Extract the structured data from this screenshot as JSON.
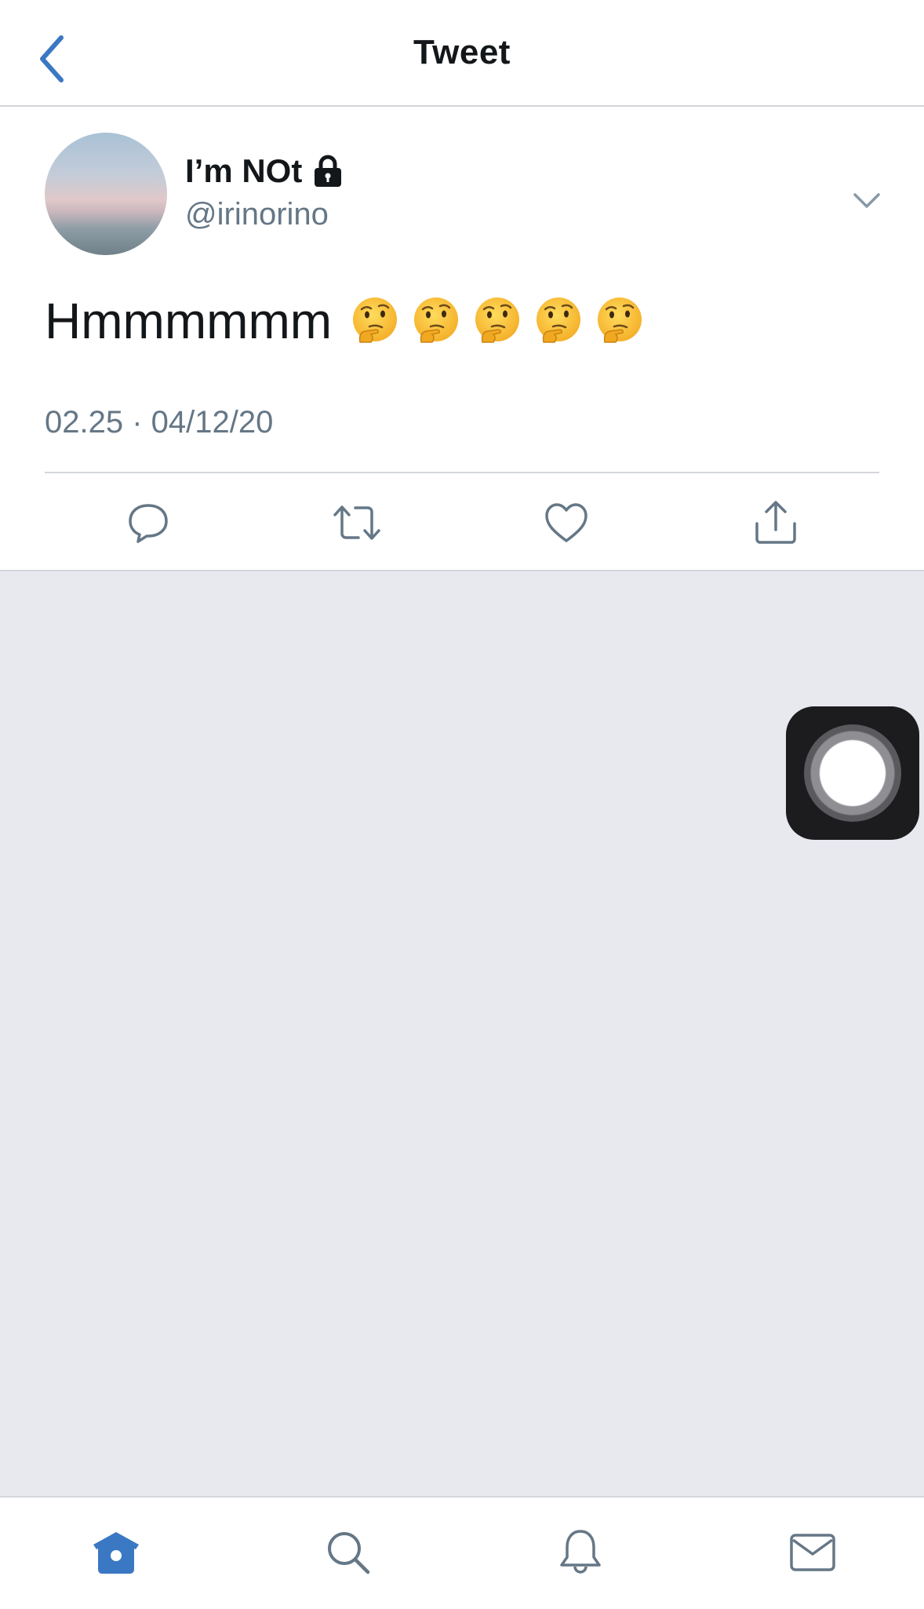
{
  "header": {
    "title": "Tweet"
  },
  "tweet": {
    "display_name": "I’m NOt",
    "handle": "@irinorino",
    "text": "Hmmmmmm",
    "timestamp": "02.25 · 04/12/20",
    "emoji_count": 5
  },
  "colors": {
    "accent": "#3b78c3",
    "secondary_text": "#657786",
    "divider": "#d3d6da",
    "background": "#e8e9ef"
  },
  "icons": {
    "back": "chevron-left-icon",
    "lock": "lock-icon",
    "more": "chevron-down-icon",
    "reply": "reply-icon",
    "retweet": "retweet-icon",
    "like": "heart-icon",
    "share": "share-icon",
    "home": "home-icon",
    "search": "search-icon",
    "notifications": "bell-icon",
    "messages": "mail-icon"
  }
}
